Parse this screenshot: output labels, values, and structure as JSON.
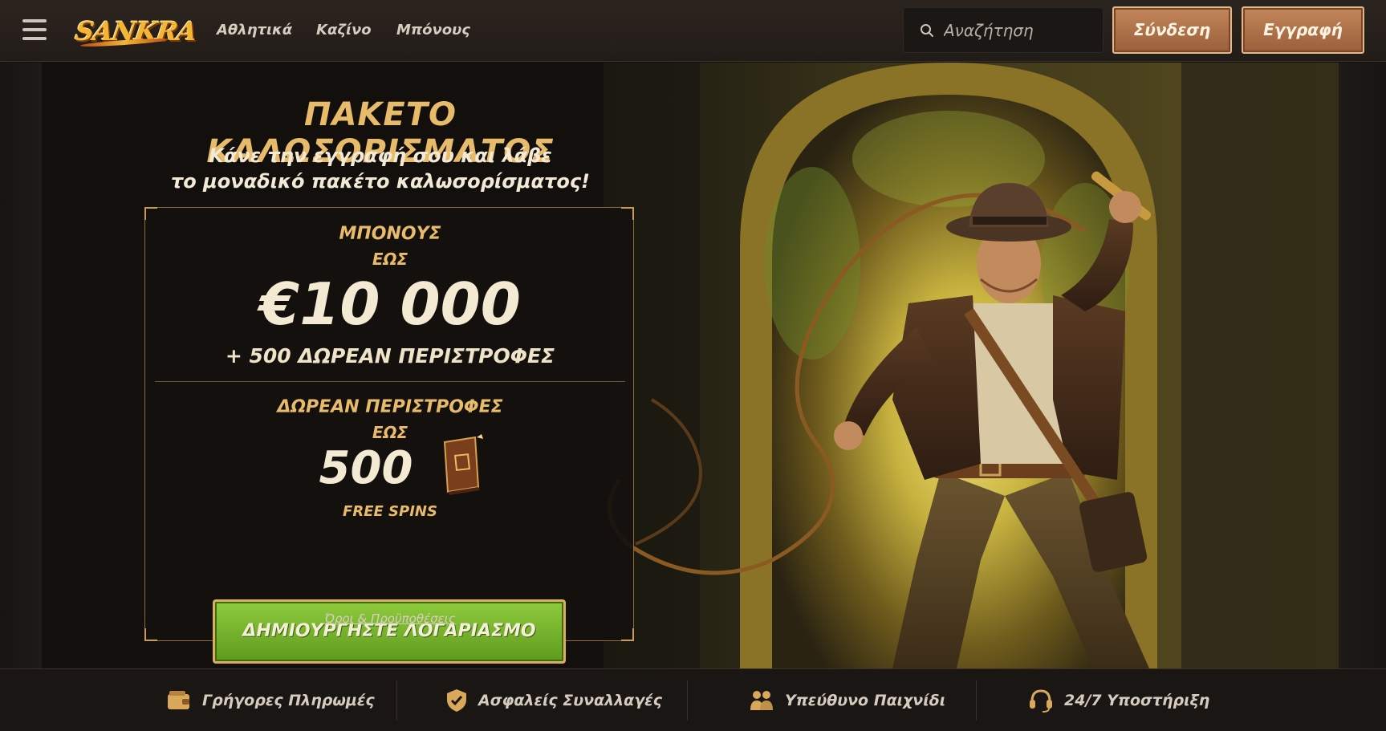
{
  "header": {
    "logo_text": "SANKRA",
    "nav": [
      "Αθλητικά",
      "Καζίνο",
      "Μπόνους"
    ],
    "search_placeholder": "Αναζήτηση",
    "login_label": "Σύνδεση",
    "register_label": "Εγγραφή"
  },
  "hero": {
    "title": "ΠΑΚΕΤΟ ΚΑΛΩΣΟΡΙΣΜΑΤΟΣ",
    "subtitle_line1": "Κάνε την εγγραφή σου και λάβε",
    "subtitle_line2": "το μοναδικό πακέτο καλωσορίσματος!",
    "bonus_label": "ΜΠΟΝΟΥΣ",
    "bonus_upto": "ΕΩΣ",
    "bonus_amount": "€10 000",
    "bonus_extra": "+ 500 ΔΩΡΕΑΝ ΠΕΡΙΣΤΡΟΦΕΣ",
    "spins_label": "ΔΩΡΕΑΝ ΠΕΡΙΣΤΡΟΦΕΣ",
    "spins_upto": "ΕΩΣ",
    "spins_amount": "500",
    "spins_caption": "FREE SPINS",
    "cta_label": "ΔΗΜΙΟΥΡΓΗΣΤΕ ΛΟΓΑΡΙΑΣΜΟ",
    "terms_label": "Όροι & Προϋποθέσεις"
  },
  "features": [
    {
      "label": "Γρήγορες Πληρωμές",
      "icon": "wallet-icon"
    },
    {
      "label": "Ασφαλείς Συναλλαγές",
      "icon": "shield-check-icon"
    },
    {
      "label": "Υπεύθυνο Παιχνίδι",
      "icon": "people-icon"
    },
    {
      "label": "24/7 Υποστήριξη",
      "icon": "headset-icon"
    }
  ],
  "colors": {
    "gold": "#e8bb6a",
    "cta_green": "#7ab52e",
    "button_brown": "#b0764d",
    "background": "#141110"
  }
}
